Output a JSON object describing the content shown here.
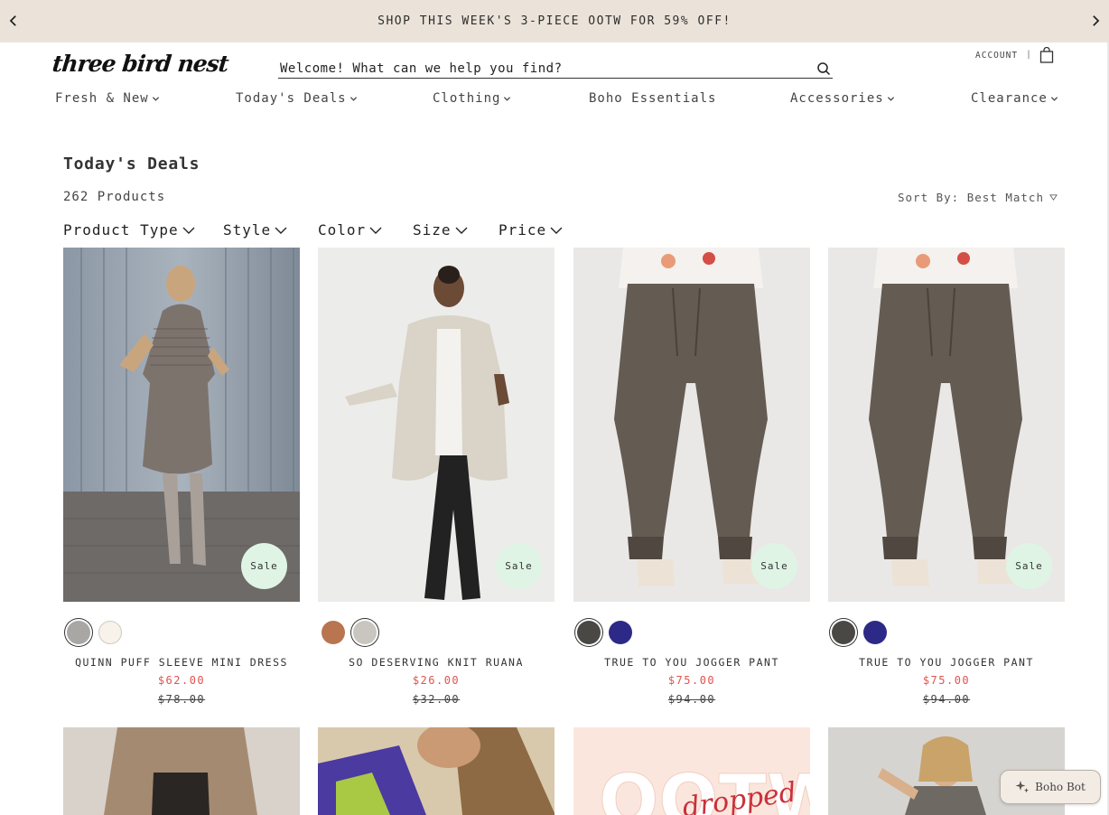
{
  "promo": {
    "text": "SHOP THIS WEEK'S 3-PIECE OOTW FOR 59% OFF!",
    "prev_icon": "chevron-left-icon",
    "next_icon": "chevron-right-icon"
  },
  "header": {
    "logo": "three bird nest",
    "search_placeholder": "Welcome! What can we help you find?",
    "account": "ACCOUNT",
    "divider": "|",
    "bag_icon": "shopping-bag-icon"
  },
  "nav": [
    {
      "label": "Fresh & New",
      "has_dropdown": true
    },
    {
      "label": "Today's Deals",
      "has_dropdown": true
    },
    {
      "label": "Clothing",
      "has_dropdown": true
    },
    {
      "label": "Boho Essentials",
      "has_dropdown": false
    },
    {
      "label": "Accessories",
      "has_dropdown": true
    },
    {
      "label": "Clearance",
      "has_dropdown": true
    }
  ],
  "page": {
    "title": "Today's Deals",
    "count": "262 Products",
    "sort_label": "Sort By: Best Match"
  },
  "filters": [
    "Product Type",
    "Style",
    "Color",
    "Size",
    "Price"
  ],
  "products": [
    {
      "name": "QUINN PUFF SLEEVE MINI DRESS",
      "price": "$62.00",
      "compare_price": "$78.00",
      "badge": "Sale",
      "swatches": [
        "#a9a7a4",
        "#f7f2ea"
      ],
      "selected_swatch": 0
    },
    {
      "name": "SO DESERVING KNIT RUANA",
      "price": "$26.00",
      "compare_price": "$32.00",
      "badge": "Sale",
      "swatches": [
        "#b87550",
        "#c9c5bf"
      ],
      "selected_swatch": 1
    },
    {
      "name": "TRUE TO YOU JOGGER PANT",
      "price": "$75.00",
      "compare_price": "$94.00",
      "badge": "Sale",
      "swatches": [
        "#4a4845",
        "#2d2a87"
      ],
      "selected_swatch": 0
    },
    {
      "name": "TRUE TO YOU JOGGER PANT",
      "price": "$75.00",
      "compare_price": "$94.00",
      "badge": "Sale",
      "swatches": [
        "#4a4845",
        "#2d2a87"
      ],
      "selected_swatch": 0
    }
  ],
  "bottom_row": {
    "promo_tile_text": "OOTW",
    "promo_tile_script": "dropped"
  },
  "boho_bot": {
    "label": "Boho Bot",
    "icon": "sparkle-icon"
  },
  "colors": {
    "promo_bg": "#ebe3d9",
    "sale_badge": "#dff4e5",
    "sale_price": "#e0534f"
  }
}
